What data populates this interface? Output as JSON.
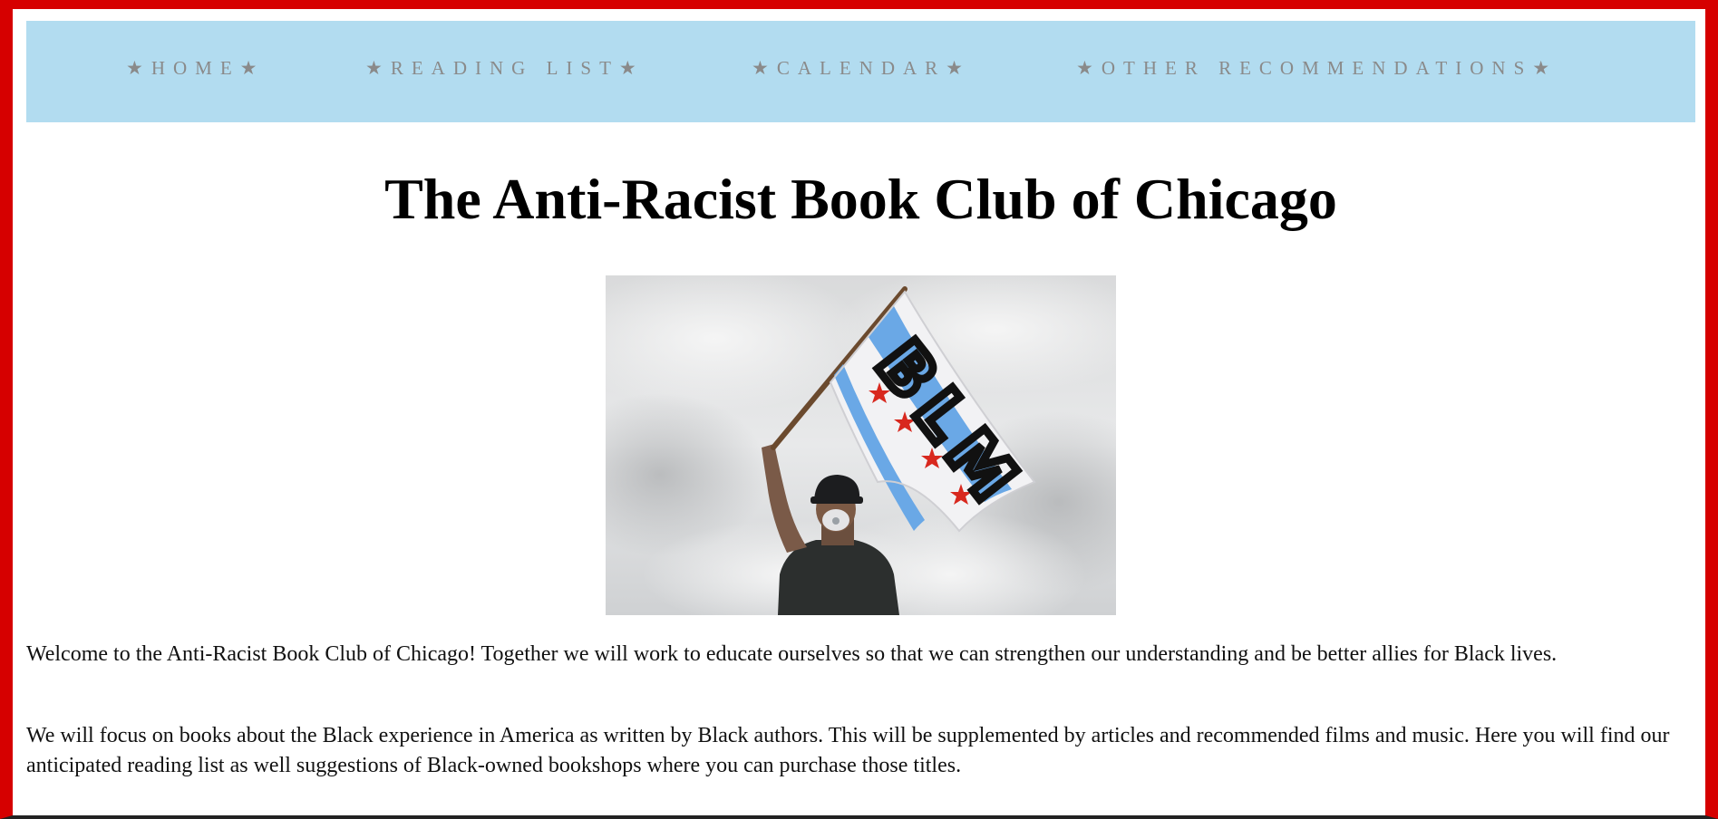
{
  "nav": {
    "items": [
      {
        "label": "★HOME★"
      },
      {
        "label": "★READING LIST★"
      },
      {
        "label": "★CALENDAR★"
      },
      {
        "label": "★OTHER RECOMMENDATIONS★"
      }
    ]
  },
  "page": {
    "title": "The Anti-Racist Book Club of Chicago"
  },
  "hero": {
    "flag_text": "BLM"
  },
  "intro": {
    "paragraphs": [
      "Welcome to the Anti-Racist Book Club of Chicago! Together we will work to educate ourselves so that we can strengthen our understanding and be better allies for Black lives.",
      "We will focus on books about the Black experience in America as written by Black authors. This will be supplemented by articles and recommended films and music. Here you will find our anticipated reading list as well suggestions of Black-owned bookshops where you can purchase those titles."
    ]
  },
  "colors": {
    "frame": "#d60000",
    "nav_background": "#b2dcf0",
    "nav_text": "#8a8a8a",
    "flag_stripe": "#6aa8e6",
    "flag_star": "#d8281e"
  }
}
